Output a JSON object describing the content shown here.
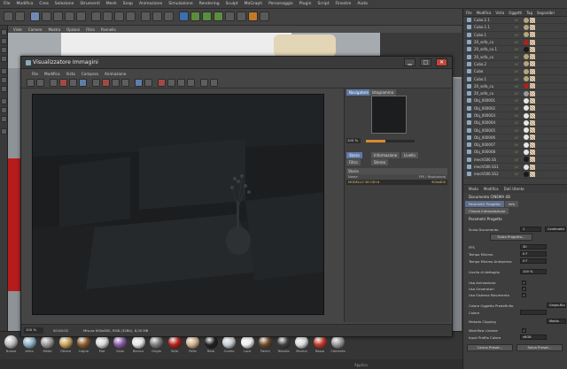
{
  "menubar": [
    "File",
    "Modifica",
    "Crea",
    "Selezione",
    "Strumenti",
    "Mesh",
    "Snap",
    "Animazione",
    "Simulazione",
    "Rendering",
    "Sculpt",
    "MoGraph",
    "Personaggio",
    "Plugin",
    "Script",
    "Finestre",
    "Aiuto"
  ],
  "viewport": {
    "menu": [
      "Viste",
      "Camere",
      "Mostra",
      "Opzioni",
      "Filtro",
      "Pannello"
    ]
  },
  "viewer": {
    "title": "Visualizzatore Immagini",
    "controls": {
      "minimize": "▁",
      "maximize": "□",
      "close": "✕"
    },
    "menu": [
      "File",
      "Modifica",
      "Vista",
      "Compara",
      "Animazione"
    ],
    "side_tabs": [
      "Navigatore",
      "Istogramma"
    ],
    "zoom_value": "100 %",
    "zoom_fraction": 0.4,
    "info_tabs_row1": [
      "Storia",
      "Informazione",
      "Livello"
    ],
    "info_tabs_row2": [
      "Filtro",
      "Stereo"
    ],
    "history": {
      "title": "Storia",
      "columns": [
        "Nome",
        "FPS",
        "Risoluzione"
      ],
      "rows": [
        {
          "name": "MODELLO 3D CB+d",
          "fps": "",
          "resolution": "900x600"
        }
      ]
    },
    "status": {
      "zoom": "100 %",
      "time": "00:00:02",
      "info": "Misura 900x600, RGB (32Bit), 8,00 MB"
    }
  },
  "object_manager": {
    "menu": [
      "File",
      "Modifica",
      "Vista",
      "Oggetti",
      "Tag",
      "Segnalibri"
    ],
    "objects": [
      {
        "name": "Cubo.2.1",
        "tag": "#b3a57e"
      },
      {
        "name": "Cubo.1.1",
        "tag": "#b3a57e"
      },
      {
        "name": "Cubo.1",
        "tag": "#b3a57e"
      },
      {
        "name": "20_sofa_cu",
        "tag": "#b0211b"
      },
      {
        "name": "20_sofa_cu.1",
        "tag": "#1a1a1a"
      },
      {
        "name": "20_sofa_cu",
        "tag": "#b3a57e"
      },
      {
        "name": "Cubo.2",
        "tag": "#b3a57e"
      },
      {
        "name": "Cubo",
        "tag": "#b3a57e"
      },
      {
        "name": "Cubo.1",
        "tag": "#b3a57e"
      },
      {
        "name": "20_sofa_cu",
        "tag": "#b0211b"
      },
      {
        "name": "20_sofa_cu",
        "tag": "#9a9a9a"
      },
      {
        "name": "Obj_000001",
        "tag": "#e6e6e6"
      },
      {
        "name": "Obj_000002",
        "tag": "#e6e6e6"
      },
      {
        "name": "Obj_000003",
        "tag": "#e6e6e6"
      },
      {
        "name": "Obj_000004",
        "tag": "#e6e6e6"
      },
      {
        "name": "Obj_000005",
        "tag": "#e6e6e6"
      },
      {
        "name": "Obj_000006",
        "tag": "#e6e6e6"
      },
      {
        "name": "Obj_000007",
        "tag": "#e6e6e6"
      },
      {
        "name": "Obj_000008",
        "tag": "#e6e6e6"
      },
      {
        "name": "mech506.SS",
        "tag": "#1a1a1a"
      },
      {
        "name": "mech506.SS1",
        "tag": "#e6e6e6"
      },
      {
        "name": "mech506.SS2",
        "tag": "#1a1a1a"
      }
    ]
  },
  "attribute_manager": {
    "menu": [
      "Modo",
      "Modifica",
      "Dati Utente"
    ],
    "title": "Documento CINEMA 4D",
    "tabs": [
      "Parametri Progetto",
      "Info",
      "Chiave Interpolazione"
    ],
    "section": "Parametri Progetto",
    "fields": [
      {
        "label": "Scala Documento",
        "value": "1",
        "unit": "Centimetri"
      },
      {
        "label": "FPS",
        "value": "30"
      },
      {
        "label": "Tempo Minimo",
        "value": "0 F"
      },
      {
        "label": "Tempo Minimo Anteprima",
        "value": "0 F"
      },
      {
        "label": "Livello di dettaglio",
        "value": "100 %"
      }
    ],
    "scale_button": "Scala Progetto...",
    "checks": [
      {
        "label": "Usa Animazione",
        "value": "✓"
      },
      {
        "label": "Usa Generatori",
        "value": "✓"
      },
      {
        "label": "Usa Sistema Movimento",
        "value": "✓"
      }
    ],
    "color_rows": [
      {
        "label": "Colore Oggetto Predefinito",
        "value": "Grigio-Blu"
      },
      {
        "label": "Colore",
        "value": ""
      },
      {
        "label": "Metodo Clipping",
        "value": "Medio"
      },
      {
        "label": "Workflow Lineare",
        "value": "✓"
      },
      {
        "label": "Input Profilo Colore",
        "value": "sRGB"
      }
    ],
    "buttons": [
      "Carica Preset...",
      "Salva Preset..."
    ]
  },
  "materials": [
    {
      "label": "Nuovo",
      "color": "#b9b9b9"
    },
    {
      "label": "Vetro",
      "color": "#8fb1c9"
    },
    {
      "label": "Metal",
      "color": "#9a9a9a"
    },
    {
      "label": "Ottone",
      "color": "#c9a257"
    },
    {
      "label": "Legno",
      "color": "#8b5a2b"
    },
    {
      "label": "Mat",
      "color": "#d9d9d9"
    },
    {
      "label": "Viola",
      "color": "#8a5ba8"
    },
    {
      "label": "Bianco",
      "color": "#e8e8e8"
    },
    {
      "label": "Grigio",
      "color": "#7d7d7d"
    },
    {
      "label": "Sofa",
      "color": "#b4211b"
    },
    {
      "label": "Pelle",
      "color": "#d1b48c"
    },
    {
      "label": "Nero",
      "color": "#222222"
    },
    {
      "label": "Cromo",
      "color": "#c6cdd2"
    },
    {
      "label": "Luce",
      "color": "#f0f0f0"
    },
    {
      "label": "Pavim",
      "color": "#6c4a2a"
    },
    {
      "label": "Tessuto",
      "color": "#3f3f3f"
    },
    {
      "label": "Marmo",
      "color": "#dcdcdc"
    },
    {
      "label": "Rosso",
      "color": "#c0392b"
    },
    {
      "label": "Cemento",
      "color": "#9a9a9a"
    }
  ],
  "bottom_status": [
    "Applica"
  ]
}
